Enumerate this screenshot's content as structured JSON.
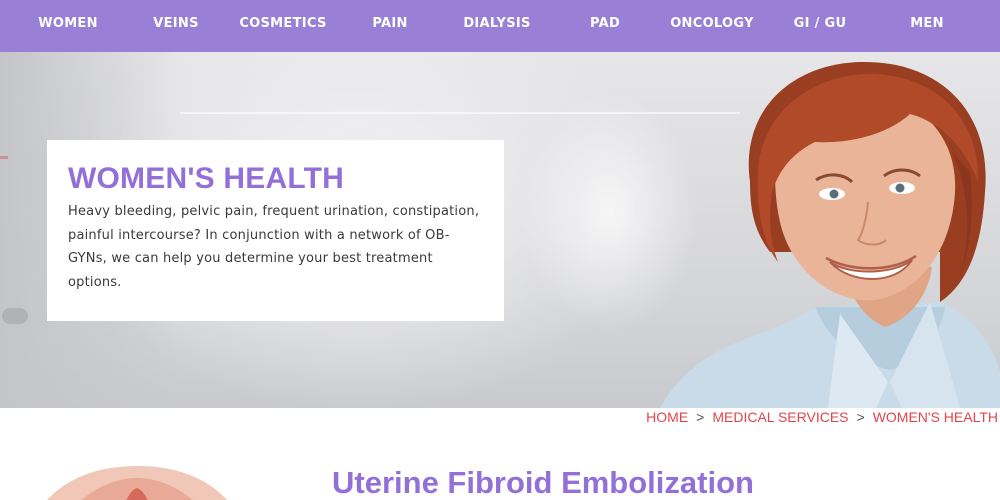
{
  "nav": {
    "items": [
      {
        "label": "WOMEN"
      },
      {
        "label": "VEINS"
      },
      {
        "label": "COSMETICS"
      },
      {
        "label": "PAIN"
      },
      {
        "label": "DIALYSIS"
      },
      {
        "label": "PAD"
      },
      {
        "label": "ONCOLOGY"
      },
      {
        "label": "GI / GU"
      },
      {
        "label": "MEN"
      }
    ]
  },
  "hero": {
    "title": "WOMEN'S HEALTH",
    "description": "Heavy bleeding, pelvic pain, frequent urination, constipation, painful intercourse? In conjunction with a network of OB-GYNs, we can help you determine your best treatment options."
  },
  "breadcrumb": {
    "items": [
      "HOME",
      "MEDICAL SERVICES",
      "WOMEN'S HEALTH"
    ],
    "separator": ">"
  },
  "section": {
    "heading": "Uterine Fibroid Embolization"
  },
  "colors": {
    "nav_bg": "#9a7fd6",
    "accent": "#9370d8",
    "breadcrumb": "#e0454b"
  }
}
